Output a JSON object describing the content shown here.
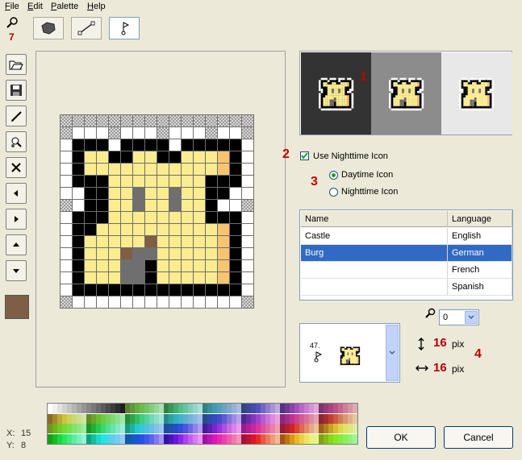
{
  "menu": {
    "file": "File",
    "edit": "Edit",
    "palette": "Palette",
    "help": "Help"
  },
  "toolbar": {
    "zoom_value": "7",
    "tools": [
      "shape-fill-tool",
      "line-tool",
      "flag-tool"
    ]
  },
  "side_buttons": [
    "open",
    "save",
    "pencil",
    "fill",
    "clear",
    "left",
    "right",
    "up",
    "down"
  ],
  "current_color": "#7E5E44",
  "annotations": {
    "n1": "1",
    "n2": "2",
    "n3": "3",
    "n4": "4"
  },
  "preview": {
    "backgrounds": [
      "#333333",
      "#8C8C8C",
      "#E8E8E8"
    ]
  },
  "options": {
    "use_nighttime_label": "Use Nighttime Icon",
    "use_nighttime_checked": true,
    "daytime_label": "Daytime Icon",
    "nighttime_label": "Nighttime Icon",
    "selected_mode": "daytime"
  },
  "lang_table": {
    "col_name": "Name",
    "col_language": "Language",
    "rows": [
      {
        "name": "Castle",
        "language": "English",
        "selected": false
      },
      {
        "name": "Burg",
        "language": "German",
        "selected": true
      },
      {
        "name": "",
        "language": "French",
        "selected": false
      },
      {
        "name": "",
        "language": "Spanish",
        "selected": false
      }
    ]
  },
  "zoom_select": {
    "value": "0"
  },
  "icon_list": {
    "item_index": "47."
  },
  "size": {
    "height_value": "16",
    "width_value": "16",
    "unit": "pix"
  },
  "coords": {
    "x_label": "X:",
    "x_value": "15",
    "y_label": "Y:",
    "y_value": "8"
  },
  "buttons": {
    "ok": "OK",
    "cancel": "Cancel"
  },
  "pixel_colors": {
    "W": "#FFFFFF",
    "K": "#000000",
    "Y": "#FBEC8F",
    "O": "#F8C470",
    "G": "#6F6F6F",
    "B": "#7E5E44",
    "T": "transparent"
  },
  "pixel_rows": [
    "TTTTTTTTTTTTTTTT",
    "TWWWTWWWTWWWTWWT",
    "WKKKWKKKKWKKKKKW",
    "WKYYKKYYKKYYYOKW",
    "WKYYYYYYYYYYYOKW",
    "WKKKYYYYYYYYKKKW",
    "WWKKYYGYYGYYKKWW",
    "TWKKYYGYYGYYKWWT",
    "WKKKYYYYYYYYKKKW",
    "WKKYYYYYYYYYYOKW",
    "WKYYYYYBYYYYYOKW",
    "WKYYYBGGYYYYYOKW",
    "WKYYYGGKYYYYYOKW",
    "WKYYYGGKYYYYYOKW",
    "WKKKKKKKKKKKKKKW",
    "TWWWWWWWWWWWWWWT"
  ]
}
